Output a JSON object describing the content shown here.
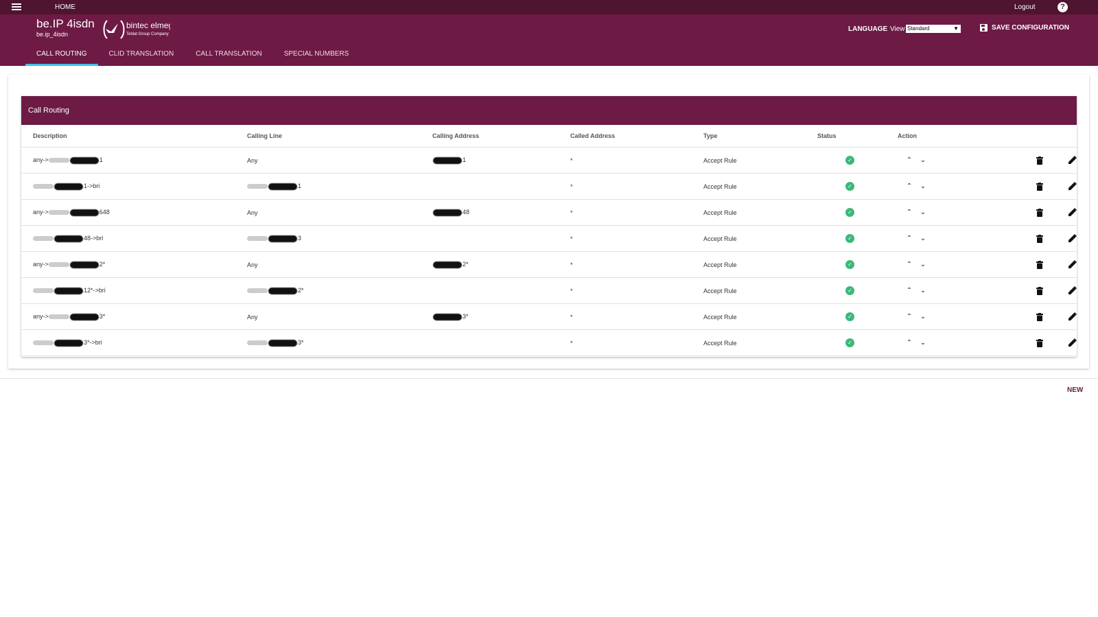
{
  "topbar": {
    "home_label": "HOME",
    "logout_label": "Logout",
    "help_icon": "question-circle-icon"
  },
  "header": {
    "app_title": "be.IP 4isdn",
    "app_subtitle": "be.ip_4isdn",
    "brand_name": "bintec elmeg",
    "brand_tagline": "Teldat Group Company",
    "language_label": "LANGUAGE",
    "view_label": "View",
    "view_selected": "Standard",
    "save_label": "SAVE CONFIGURATION"
  },
  "tabs": [
    {
      "label": "CALL ROUTING",
      "active": true
    },
    {
      "label": "CLID TRANSLATION",
      "active": false
    },
    {
      "label": "CALL TRANSLATION",
      "active": false
    },
    {
      "label": "SPECIAL NUMBERS",
      "active": false
    }
  ],
  "table": {
    "title": "Call Routing",
    "columns": [
      "Description",
      "Calling Line",
      "Calling Address",
      "Called Address",
      "Type",
      "Status",
      "Action"
    ],
    "rows": [
      {
        "desc_pre": "any->",
        "desc_post": "1",
        "line": "Any",
        "line_blur": false,
        "caddr": "1",
        "called": "*",
        "type": "Accept Rule"
      },
      {
        "desc_pre": "",
        "desc_post": "1->bri",
        "line": "",
        "line_blur": true,
        "line_post": "1",
        "caddr": "",
        "called": "*",
        "type": "Accept Rule"
      },
      {
        "desc_pre": "any->",
        "desc_post": "648",
        "line": "Any",
        "line_blur": false,
        "caddr": "48",
        "called": "*",
        "type": "Accept Rule"
      },
      {
        "desc_pre": "",
        "desc_post": "48->bri",
        "line": "",
        "line_blur": true,
        "line_post": "3",
        "caddr": "",
        "called": "*",
        "type": "Accept Rule"
      },
      {
        "desc_pre": "any->",
        "desc_post": "2*",
        "line": "Any",
        "line_blur": false,
        "caddr": "2*",
        "called": "*",
        "type": "Accept Rule"
      },
      {
        "desc_pre": "",
        "desc_post": "12*->bri",
        "line": "",
        "line_blur": true,
        "line_post": "2*",
        "caddr": "",
        "called": "*",
        "type": "Accept Rule"
      },
      {
        "desc_pre": "any->",
        "desc_post": "3*",
        "line": "Any",
        "line_blur": false,
        "caddr": "3*",
        "called": "*",
        "type": "Accept Rule"
      },
      {
        "desc_pre": "",
        "desc_post": "3*->bri",
        "line": "",
        "line_blur": true,
        "line_post": "3*",
        "caddr": "",
        "called": "*",
        "type": "Accept Rule"
      }
    ]
  },
  "footer": {
    "new_label": "NEW"
  },
  "colors": {
    "topbar": "#4f1430",
    "header": "#6d1a45",
    "tab_indicator": "#3fc2e6",
    "status_ok": "#3cb878"
  }
}
